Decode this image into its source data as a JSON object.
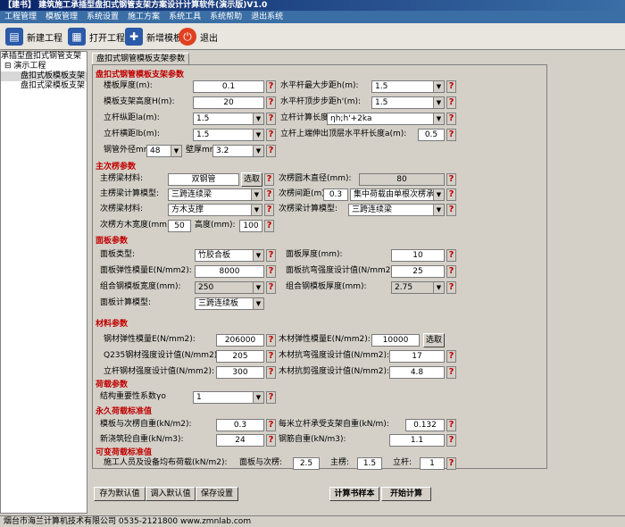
{
  "title": "【建书】 建筑施工承插型盘扣式钢管支架方案设计计算软件(演示版)V1.0",
  "menu": [
    "工程管理",
    "模板管理",
    "系统设置",
    "施工方案",
    "系统工具",
    "系统帮助",
    "退出系统"
  ],
  "toolbar": {
    "new_project": "新建工程",
    "open_project": "打开工程",
    "add_template": "新增模板",
    "exit": "退出"
  },
  "tree": {
    "root": "承插型盘扣式钢管支架",
    "project": "演示工程",
    "item1": "盘扣式板模板支架",
    "item2": "盘扣式梁模板支架"
  },
  "tab": "盘扣式钢管模板支架参数",
  "sections": {
    "s1": "盘扣式钢管模板支架参数",
    "s2": "主次楞参数",
    "s3": "面板参数",
    "s4": "材料参数",
    "s5": "荷载参数",
    "s6": "永久荷载标准值",
    "s7": "可变荷载标准值"
  },
  "labels": {
    "slab_thick": "楼板厚度(m):",
    "height": "模板支架高度H(m):",
    "la": "立杆纵距la(m):",
    "lb": "立杆横距lb(m):",
    "pipe": "钢管外径mm",
    "wall": "壁厚mm",
    "hmax": "水平杆最大步距h(m):",
    "htop": "水平杆顶步步距h'(m):",
    "calc_len": "立杆计算长度:",
    "top_ext": "立杆上端伸出顶层水平杆长度a(m):",
    "main_mat": "主楞梁材料:",
    "select": "选取",
    "sec_dia": "次楞圆木直径(mm):",
    "main_model": "主楞梁计算模型:",
    "sec_space": "次楞间距(m)",
    "sec_mat": "次楞梁材料:",
    "sec_model": "次楞梁计算模型:",
    "sec_w": "次楞方木宽度(mm):",
    "sec_h": "高度(mm):",
    "panel_type": "面板类型:",
    "panel_thick": "面板厚度(mm):",
    "panel_E": "面板弹性模量E(N/mm2):",
    "panel_fm": "面板抗弯强度设计值(N/mm2):",
    "steel_w": "组合钢模板宽度(mm):",
    "steel_t": "组合钢模板厚度(mm):",
    "panel_model": "面板计算模型:",
    "steel_E": "钢材弹性模量E(N/mm2):",
    "wood_E": "木材弹性模量E(N/mm2):",
    "q235": "Q235钢材强度设计值(N/mm2):",
    "wood_fm": "木材抗弯强度设计值(N/mm2):",
    "pole_q": "立杆钢材强度设计值(N/mm2):",
    "wood_fv": "木材抗剪强度设计值(N/mm2):",
    "gamma": "结构重要性系数γo",
    "g_form": "模板与次楞自重(kN/m2):",
    "g_pole": "每米立杆承受支架自重(kN/m):",
    "g_conc": "新浇筑砼自重(kN/m3):",
    "g_rebar": "钢筋自重(kN/m3):",
    "q_live": "施工人员及设备均布荷载(kN/m2):",
    "q_panel": "面板与次楞:",
    "q_main": "主楞:",
    "q_pole": "立杆:"
  },
  "values": {
    "slab_thick": "0.1",
    "height": "20",
    "la": "1.5",
    "lb": "1.5",
    "pipe": "48",
    "wall": "3.2",
    "hmax": "1.5",
    "htop": "1.5",
    "calc_len": "ηh;h'+2ka",
    "top_ext": "0.5",
    "main_mat": "双钢管",
    "sec_dia": "80",
    "main_model": "三跨连续梁",
    "sec_space": "0.3",
    "sec_note": "集中荷载由单根次楞承担",
    "sec_mat": "方木支撑",
    "sec_model": "三跨连续梁",
    "sec_w": "50",
    "sec_h": "100",
    "panel_type": "竹胶合板",
    "panel_thick": "10",
    "panel_E": "8000",
    "panel_fm": "25",
    "steel_w": "250",
    "steel_t": "2.75",
    "panel_model": "三跨连续板",
    "steel_E": "206000",
    "wood_E": "10000",
    "q235": "205",
    "wood_fm": "17",
    "pole_q": "300",
    "wood_fv": "4.8",
    "gamma": "1",
    "g_form": "0.3",
    "g_pole": "0.132",
    "g_conc": "24",
    "g_rebar": "1.1",
    "q_panel": "2.5",
    "q_main": "1.5",
    "q_pole": "1"
  },
  "buttons": {
    "save_default": "存为默认值",
    "load_default": "调入默认值",
    "save_settings": "保存设置",
    "sample": "计算书样本",
    "start": "开始计算"
  },
  "status": "烟台市海兰计算机技术有限公司 0535-2121800 www.zmnlab.com"
}
